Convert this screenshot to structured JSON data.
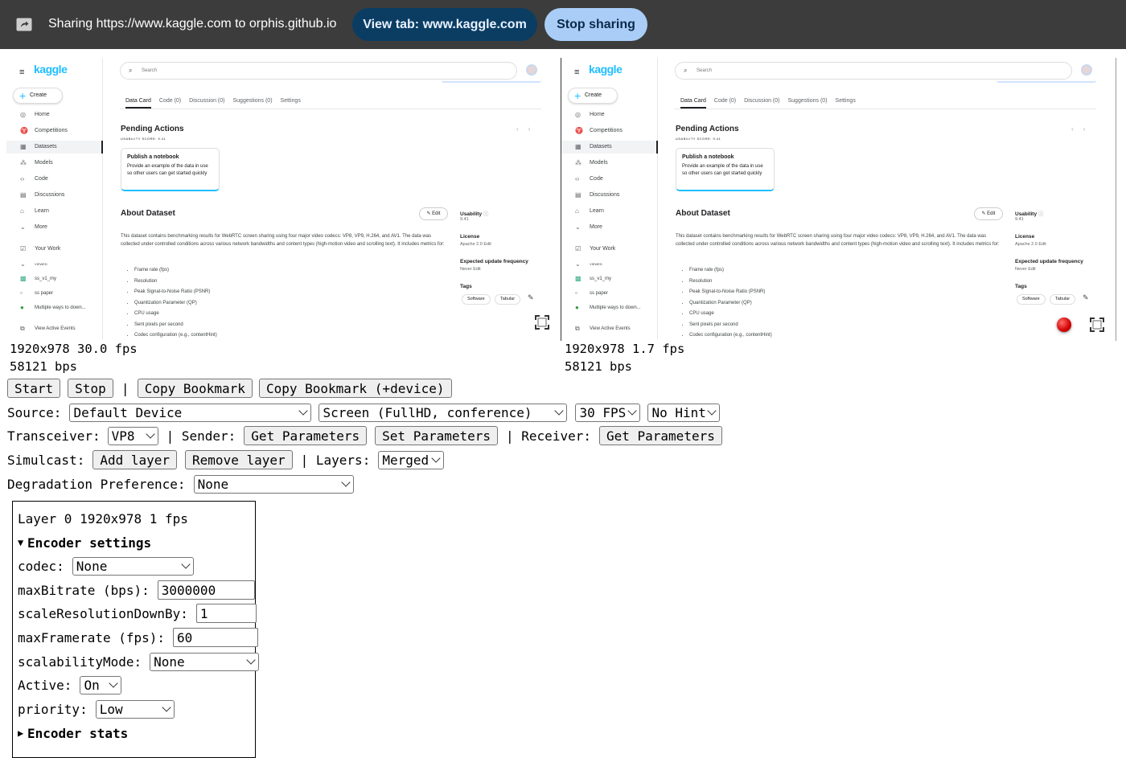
{
  "sharebar": {
    "text": "Sharing https://www.kaggle.com to orphis.github.io",
    "view_tab_label": "View tab: www.kaggle.com",
    "stop_sharing_label": "Stop sharing"
  },
  "kaggle": {
    "logo": "kaggle",
    "create": "Create",
    "nav": [
      "Home",
      "Competitions",
      "Datasets",
      "Models",
      "Code",
      "Discussions",
      "Learn",
      "More"
    ],
    "your_work": "Your Work",
    "viewed": "VIEWED",
    "recent": [
      "ss_v1_my",
      "ss paper",
      "Multiple ways to down..."
    ],
    "view_active_events": "View Active Events",
    "search_placeholder": "Search",
    "tabs": [
      "Data Card",
      "Code (0)",
      "Discussion (0)",
      "Suggestions (0)",
      "Settings"
    ],
    "pending_actions": "Pending Actions",
    "usability_score": "USABILITY SCORE: 9.41",
    "card_title": "Publish a notebook",
    "card_body": "Provide an example of the data in use so other users can get started quickly",
    "about": "About Dataset",
    "edit": "Edit",
    "description": "This dataset contains benchmarking results for WebRTC screen sharing using four major video codecs: VP8, VP9, H.264, and AV1. The data was collected under controlled conditions across various network bandwidths and content types (high-motion video and scrolling text). It includes metrics for:",
    "metrics": [
      "Frame rate (fps)",
      "Resolution",
      "Peak Signal-to-Noise Ratio (PSNR)",
      "Quantization Parameter (QP)",
      "CPU usage",
      "Sent pixels per second",
      "Codec configuration (e.g., contentHint)"
    ],
    "usability_label": "Usability",
    "usability_value": "9.41",
    "license_label": "License",
    "license_value": "Apache 2.0 Edit",
    "update_label": "Expected update frequency",
    "update_value": "Never Edit",
    "tags_label": "Tags",
    "tags": [
      "Software",
      "Tabular"
    ]
  },
  "stats": {
    "left_res": "1920x978 30.0 fps",
    "left_bps": "58121 bps",
    "right_res": "1920x978 1.7 fps",
    "right_bps": "58121 bps"
  },
  "controls": {
    "start": "Start",
    "stop": "Stop",
    "sep": "|",
    "copy_bookmark": "Copy Bookmark",
    "copy_bookmark_device": "Copy Bookmark (+device)",
    "source_label": "Source:",
    "source_device": "Default Device",
    "source_screen": "Screen (FullHD, conference)",
    "source_fps": "30 FPS",
    "source_hint": "No Hint",
    "transceiver_label": "Transceiver:",
    "transceiver_codec": "VP8",
    "sender_label": "| Sender:",
    "get_parameters": "Get Parameters",
    "set_parameters": "Set Parameters",
    "receiver_label": "| Receiver:",
    "simulcast_label": "Simulcast:",
    "add_layer": "Add layer",
    "remove_layer": "Remove layer",
    "layers_label": "| Layers:",
    "layers_value": "Merged",
    "degradation_label": "Degradation Preference:",
    "degradation_value": "None"
  },
  "layer": {
    "title": "Layer 0 1920x978 1 fps",
    "encoder_settings": "Encoder settings",
    "codec_label": "codec:",
    "codec_value": "None",
    "maxbitrate_label": "maxBitrate (bps):",
    "maxbitrate_value": "3000000",
    "scale_label": "scaleResolutionDownBy:",
    "scale_value": "1",
    "maxframerate_label": "maxFramerate (fps):",
    "maxframerate_value": "60",
    "scalability_label": "scalabilityMode:",
    "scalability_value": "None",
    "active_label": "Active:",
    "active_value": "On",
    "priority_label": "priority:",
    "priority_value": "Low",
    "encoder_stats": "Encoder stats"
  }
}
